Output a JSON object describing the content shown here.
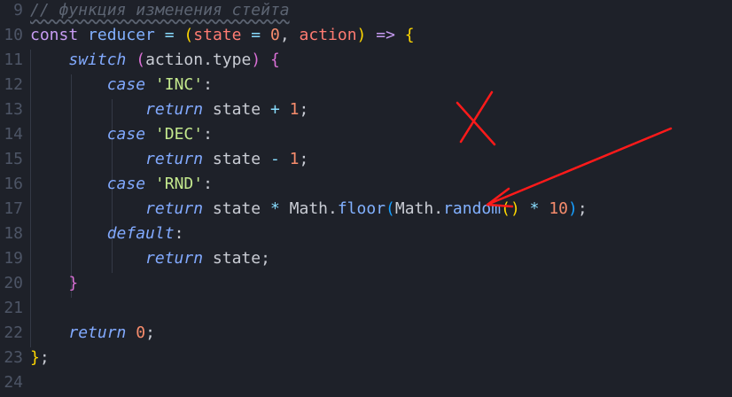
{
  "editor": {
    "lines": [
      {
        "num": "9",
        "tokens": [
          {
            "t": "// функция изменения стейта",
            "c": "tok-comment"
          }
        ]
      },
      {
        "num": "10",
        "tokens": [
          {
            "t": "const",
            "c": "tok-keyword"
          },
          {
            "t": " "
          },
          {
            "t": "reducer",
            "c": "tok-fn"
          },
          {
            "t": " "
          },
          {
            "t": "=",
            "c": "tok-op"
          },
          {
            "t": " "
          },
          {
            "t": "(",
            "c": "tok-paren-y"
          },
          {
            "t": "state",
            "c": "tok-param"
          },
          {
            "t": " "
          },
          {
            "t": "=",
            "c": "tok-op"
          },
          {
            "t": " "
          },
          {
            "t": "0",
            "c": "tok-number"
          },
          {
            "t": ", ",
            "c": "tok-punct"
          },
          {
            "t": "action",
            "c": "tok-param"
          },
          {
            "t": ")",
            "c": "tok-paren-y"
          },
          {
            "t": " "
          },
          {
            "t": "=>",
            "c": "tok-keyword"
          },
          {
            "t": " "
          },
          {
            "t": "{",
            "c": "tok-paren-y"
          }
        ]
      },
      {
        "num": "11",
        "tokens": [
          {
            "t": "    "
          },
          {
            "t": "switch",
            "c": "tok-flow"
          },
          {
            "t": " "
          },
          {
            "t": "(",
            "c": "tok-paren-p"
          },
          {
            "t": "action",
            "c": "tok-var"
          },
          {
            "t": ".",
            "c": "tok-punct"
          },
          {
            "t": "type",
            "c": "tok-var"
          },
          {
            "t": ")",
            "c": "tok-paren-p"
          },
          {
            "t": " "
          },
          {
            "t": "{",
            "c": "tok-paren-p"
          }
        ]
      },
      {
        "num": "12",
        "tokens": [
          {
            "t": "        "
          },
          {
            "t": "case",
            "c": "tok-flow"
          },
          {
            "t": " "
          },
          {
            "t": "'INC'",
            "c": "tok-string"
          },
          {
            "t": ":",
            "c": "tok-punct"
          }
        ]
      },
      {
        "num": "13",
        "tokens": [
          {
            "t": "            "
          },
          {
            "t": "return",
            "c": "tok-flow"
          },
          {
            "t": " "
          },
          {
            "t": "state",
            "c": "tok-var"
          },
          {
            "t": " "
          },
          {
            "t": "+",
            "c": "tok-op"
          },
          {
            "t": " "
          },
          {
            "t": "1",
            "c": "tok-number"
          },
          {
            "t": ";",
            "c": "tok-punct"
          }
        ]
      },
      {
        "num": "14",
        "tokens": [
          {
            "t": "        "
          },
          {
            "t": "case",
            "c": "tok-flow"
          },
          {
            "t": " "
          },
          {
            "t": "'DEC'",
            "c": "tok-string"
          },
          {
            "t": ":",
            "c": "tok-punct"
          }
        ]
      },
      {
        "num": "15",
        "tokens": [
          {
            "t": "            "
          },
          {
            "t": "return",
            "c": "tok-flow"
          },
          {
            "t": " "
          },
          {
            "t": "state",
            "c": "tok-var"
          },
          {
            "t": " "
          },
          {
            "t": "-",
            "c": "tok-op"
          },
          {
            "t": " "
          },
          {
            "t": "1",
            "c": "tok-number"
          },
          {
            "t": ";",
            "c": "tok-punct"
          }
        ]
      },
      {
        "num": "16",
        "tokens": [
          {
            "t": "        "
          },
          {
            "t": "case",
            "c": "tok-flow"
          },
          {
            "t": " "
          },
          {
            "t": "'RND'",
            "c": "tok-string"
          },
          {
            "t": ":",
            "c": "tok-punct"
          }
        ]
      },
      {
        "num": "17",
        "tokens": [
          {
            "t": "            "
          },
          {
            "t": "return",
            "c": "tok-flow"
          },
          {
            "t": " "
          },
          {
            "t": "state",
            "c": "tok-var"
          },
          {
            "t": " "
          },
          {
            "t": "*",
            "c": "tok-op"
          },
          {
            "t": " "
          },
          {
            "t": "Math",
            "c": "tok-var"
          },
          {
            "t": ".",
            "c": "tok-punct"
          },
          {
            "t": "floor",
            "c": "tok-fn"
          },
          {
            "t": "(",
            "c": "tok-paren-b"
          },
          {
            "t": "Math",
            "c": "tok-var"
          },
          {
            "t": ".",
            "c": "tok-punct"
          },
          {
            "t": "random",
            "c": "tok-fn"
          },
          {
            "t": "()",
            "c": "tok-paren-y"
          },
          {
            "t": " "
          },
          {
            "t": "*",
            "c": "tok-op"
          },
          {
            "t": " "
          },
          {
            "t": "10",
            "c": "tok-number"
          },
          {
            "t": ")",
            "c": "tok-paren-b"
          },
          {
            "t": ";",
            "c": "tok-punct"
          }
        ]
      },
      {
        "num": "18",
        "tokens": [
          {
            "t": "        "
          },
          {
            "t": "default",
            "c": "tok-flow"
          },
          {
            "t": ":",
            "c": "tok-punct"
          }
        ]
      },
      {
        "num": "19",
        "tokens": [
          {
            "t": "            "
          },
          {
            "t": "return",
            "c": "tok-flow"
          },
          {
            "t": " "
          },
          {
            "t": "state",
            "c": "tok-var"
          },
          {
            "t": ";",
            "c": "tok-punct"
          }
        ]
      },
      {
        "num": "20",
        "tokens": [
          {
            "t": "    "
          },
          {
            "t": "}",
            "c": "tok-paren-p"
          }
        ]
      },
      {
        "num": "21",
        "tokens": []
      },
      {
        "num": "22",
        "tokens": [
          {
            "t": "    "
          },
          {
            "t": "return",
            "c": "tok-flow"
          },
          {
            "t": " "
          },
          {
            "t": "0",
            "c": "tok-number"
          },
          {
            "t": ";",
            "c": "tok-punct"
          }
        ]
      },
      {
        "num": "23",
        "tokens": [
          {
            "t": "}",
            "c": "tok-paren-y"
          },
          {
            "t": ";",
            "c": "tok-punct"
          }
        ]
      },
      {
        "num": "24",
        "tokens": []
      }
    ]
  },
  "annotations": {
    "color": "#ff1a1a",
    "cross_icon": "red-cross-mark-icon",
    "arrow_icon": "red-arrow-icon"
  },
  "theme": {
    "background": "#1e2129",
    "gutter_text": "#4d5566",
    "keyword": "#c79bf2",
    "string": "#c3e88d",
    "number": "#f78c6c"
  }
}
